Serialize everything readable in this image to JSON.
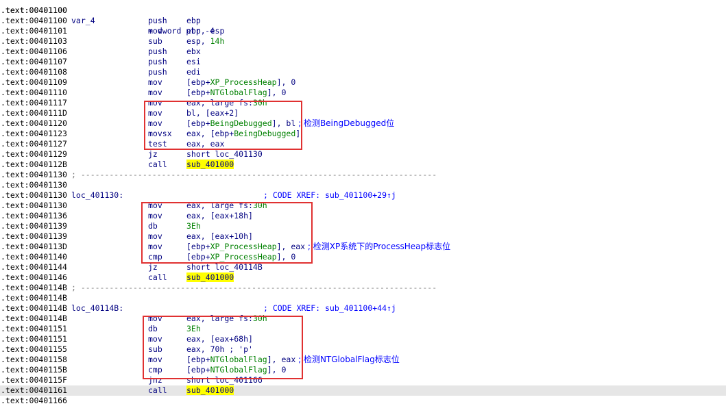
{
  "accent_colors": {
    "box": "#e03131",
    "highlight": "#ffff00",
    "comment": "#0000ff"
  },
  "header": {
    "addr": ".text:00401100",
    "name": "var_4",
    "definition": "= dword ptr -4"
  },
  "lines": [
    {
      "addr": ".text:00401100",
      "kind": "blank"
    },
    {
      "addr": ".text:00401100",
      "kind": "ins",
      "mn": "push",
      "op": "ebp"
    },
    {
      "addr": ".text:00401101",
      "kind": "ins",
      "mn": "mov",
      "op": "ebp, esp"
    },
    {
      "addr": ".text:00401103",
      "kind": "ins",
      "mn": "sub",
      "op_pre": "esp, ",
      "op_num": "14h"
    },
    {
      "addr": ".text:00401106",
      "kind": "ins",
      "mn": "push",
      "op": "ebx"
    },
    {
      "addr": ".text:00401107",
      "kind": "ins",
      "mn": "push",
      "op": "esi"
    },
    {
      "addr": ".text:00401108",
      "kind": "ins",
      "mn": "push",
      "op": "edi"
    },
    {
      "addr": ".text:00401109",
      "kind": "ins",
      "mn": "mov",
      "op_pre": "[ebp+",
      "op_name": "XP_ProcessHeap",
      "op_post": "], 0"
    },
    {
      "addr": ".text:00401110",
      "kind": "ins",
      "mn": "mov",
      "op_pre": "[ebp+",
      "op_name": "NTGlobalFlag",
      "op_post": "], 0"
    },
    {
      "addr": ".text:00401117",
      "kind": "ins",
      "mn": "mov",
      "op_pre": "eax, large fs:",
      "op_num": "30h"
    },
    {
      "addr": ".text:0040111D",
      "kind": "ins",
      "mn": "mov",
      "op": "bl, [eax+2]"
    },
    {
      "addr": ".text:00401120",
      "kind": "ins",
      "mn": "mov",
      "op_pre": "[ebp+",
      "op_name": "BeingDebugged",
      "op_post": "], bl",
      "comment": " ; 检测BeingDebugged位"
    },
    {
      "addr": ".text:00401123",
      "kind": "ins",
      "mn": "movsx",
      "op_pre": "eax, [ebp+",
      "op_name": "BeingDebugged",
      "op_post": "]"
    },
    {
      "addr": ".text:00401127",
      "kind": "ins",
      "mn": "test",
      "op": "eax, eax"
    },
    {
      "addr": ".text:00401129",
      "kind": "ins",
      "mn": "jz",
      "op": "short loc_401130"
    },
    {
      "addr": ".text:0040112B",
      "kind": "ins",
      "mn": "call",
      "op_hl": "sub_401000"
    },
    {
      "addr": ".text:00401130",
      "kind": "sep",
      "text": "; ---------------------------------------------------------------------------"
    },
    {
      "addr": ".text:00401130",
      "kind": "blank"
    },
    {
      "addr": ".text:00401130",
      "kind": "label",
      "label": "loc_401130:",
      "xref": "; CODE XREF: sub_401100+29↑j"
    },
    {
      "addr": ".text:00401130",
      "kind": "ins",
      "mn": "mov",
      "op_pre": "eax, large fs:",
      "op_num": "30h"
    },
    {
      "addr": ".text:00401136",
      "kind": "ins",
      "mn": "mov",
      "op": "eax, [eax+18h]"
    },
    {
      "addr": ".text:00401139",
      "kind": "ins",
      "mn": "db",
      "op_num": "3Eh"
    },
    {
      "addr": ".text:00401139",
      "kind": "ins",
      "mn": "mov",
      "op": "eax, [eax+10h]"
    },
    {
      "addr": ".text:0040113D",
      "kind": "ins",
      "mn": "mov",
      "op_pre": "[ebp+",
      "op_name": "XP_ProcessHeap",
      "op_post": "], eax",
      "comment": " ; 检测XP系统下的ProcessHeap标志位"
    },
    {
      "addr": ".text:00401140",
      "kind": "ins",
      "mn": "cmp",
      "op_pre": "[ebp+",
      "op_name": "XP_ProcessHeap",
      "op_post": "], 0"
    },
    {
      "addr": ".text:00401144",
      "kind": "ins",
      "mn": "jz",
      "op": "short loc_40114B"
    },
    {
      "addr": ".text:00401146",
      "kind": "ins",
      "mn": "call",
      "op_hl": "sub_401000"
    },
    {
      "addr": ".text:0040114B",
      "kind": "sep",
      "text": "; ---------------------------------------------------------------------------"
    },
    {
      "addr": ".text:0040114B",
      "kind": "blank"
    },
    {
      "addr": ".text:0040114B",
      "kind": "label",
      "label": "loc_40114B:",
      "xref": "; CODE XREF: sub_401100+44↑j"
    },
    {
      "addr": ".text:0040114B",
      "kind": "ins",
      "mn": "mov",
      "op_pre": "eax, large fs:",
      "op_num": "30h"
    },
    {
      "addr": ".text:00401151",
      "kind": "ins",
      "mn": "db",
      "op_num": "3Eh"
    },
    {
      "addr": ".text:00401151",
      "kind": "ins",
      "mn": "mov",
      "op": "eax, [eax+68h]"
    },
    {
      "addr": ".text:00401155",
      "kind": "ins",
      "mn": "sub",
      "op": "eax, 70h ; 'p'"
    },
    {
      "addr": ".text:00401158",
      "kind": "ins",
      "mn": "mov",
      "op_pre": "[ebp+",
      "op_name": "NTGlobalFlag",
      "op_post": "], eax",
      "comment": " ; 检测NTGlobalFlag标志位"
    },
    {
      "addr": ".text:0040115B",
      "kind": "ins",
      "mn": "cmp",
      "op_pre": "[ebp+",
      "op_name": "NTGlobalFlag",
      "op_post": "], 0"
    },
    {
      "addr": ".text:0040115F",
      "kind": "ins",
      "mn": "jnz",
      "op": "short loc_401166"
    },
    {
      "addr": ".text:00401161",
      "kind": "ins",
      "mn": "call",
      "op_hl": "sub_401000",
      "current": true
    },
    {
      "addr": ".text:00401166",
      "kind": "blank"
    }
  ]
}
